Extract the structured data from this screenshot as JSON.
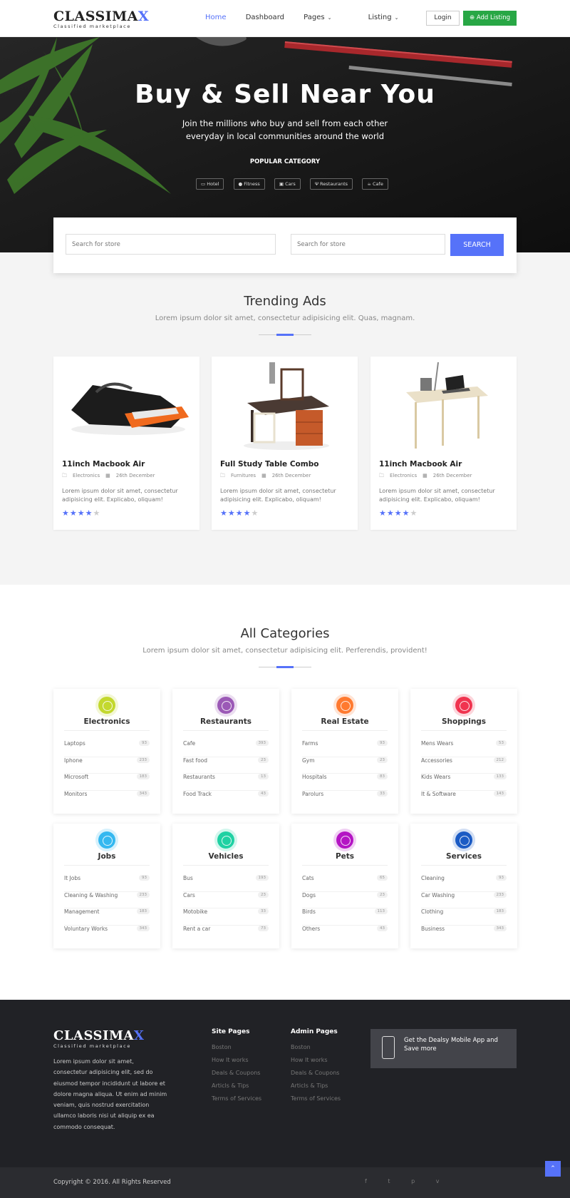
{
  "brand": {
    "name_main": "CLASSIMA",
    "name_accent": "X",
    "tagline": "Classified marketplace"
  },
  "nav": {
    "items": [
      {
        "label": "Home",
        "active": true
      },
      {
        "label": "Dashboard"
      },
      {
        "label": "Pages",
        "dropdown": true
      },
      {
        "label": "Listing",
        "dropdown": true
      }
    ],
    "login_label": "Login",
    "add_listing_label": "Add Listing",
    "add_listing_icon": "plus-circle-icon"
  },
  "hero": {
    "title": "Buy & Sell Near You",
    "subtitle": "Join the millions who buy and sell from each other everyday in local communities around the world",
    "popular_label": "POPULAR CATEGORY",
    "popular_items": [
      {
        "label": "Hotel",
        "icon": "bed-icon"
      },
      {
        "label": "Fitness",
        "icon": "fitness-icon"
      },
      {
        "label": "Cars",
        "icon": "car-icon"
      },
      {
        "label": "Restaurants",
        "icon": "cutlery-icon"
      },
      {
        "label": "Cafe",
        "icon": "coffee-icon"
      }
    ]
  },
  "search": {
    "placeholder_1": "Search for store",
    "placeholder_2": "Search for store",
    "button_label": "SEARCH"
  },
  "trending": {
    "title": "Trending Ads",
    "description": "Lorem ipsum dolor sit amet, consectetur adipisicing elit. Quas, magnam.",
    "cards": [
      {
        "title": "11inch Macbook Air",
        "category": "Electronics",
        "date": "26th December",
        "description": "Lorem ipsum dolor sit amet, consectetur adipisicing elit. Explicabo, oliquam!",
        "rating": 4,
        "rating_max": 5
      },
      {
        "title": "Full Study Table Combo",
        "category": "Furnitures",
        "date": "26th December",
        "description": "Lorem ipsum dolor sit amet, consectetur adipisicing elit. Explicabo, oliquam!",
        "rating": 4,
        "rating_max": 5
      },
      {
        "title": "11inch Macbook Air",
        "category": "Electronics",
        "date": "26th December",
        "description": "Lorem ipsum dolor sit amet, consectetur adipisicing elit. Explicabo, oliquam!",
        "rating": 4,
        "rating_max": 5
      }
    ]
  },
  "categories": {
    "title": "All Categories",
    "description": "Lorem ipsum dolor sit amet, consectetur adipisicing elit. Perferendis, provident!",
    "items": [
      {
        "name": "Electronics",
        "color": "#c3d82e",
        "icon": "laptop-icon",
        "subs": [
          [
            "Laptops",
            "93"
          ],
          [
            "Iphone",
            "233"
          ],
          [
            "Microsoft",
            "183"
          ],
          [
            "Monitors",
            "343"
          ]
        ]
      },
      {
        "name": "Restaurants",
        "color": "#9b59b6",
        "icon": "apple-icon",
        "subs": [
          [
            "Cafe",
            "393"
          ],
          [
            "Fast food",
            "23"
          ],
          [
            "Restaurants",
            "13"
          ],
          [
            "Food Track",
            "43"
          ]
        ]
      },
      {
        "name": "Real Estate",
        "color": "#ff7a2f",
        "icon": "home-icon",
        "subs": [
          [
            "Farms",
            "93"
          ],
          [
            "Gym",
            "23"
          ],
          [
            "Hospitals",
            "83"
          ],
          [
            "Parolurs",
            "33"
          ]
        ]
      },
      {
        "name": "Shoppings",
        "color": "#f0344f",
        "icon": "shopping-cart-icon",
        "subs": [
          [
            "Mens Wears",
            "53"
          ],
          [
            "Accessories",
            "212"
          ],
          [
            "Kids Wears",
            "133"
          ],
          [
            "It & Software",
            "143"
          ]
        ]
      },
      {
        "name": "Jobs",
        "color": "#34b8f0",
        "icon": "briefcase-icon",
        "subs": [
          [
            "It Jobs",
            "93"
          ],
          [
            "Cleaning & Washing",
            "233"
          ],
          [
            "Management",
            "183"
          ],
          [
            "Voluntary Works",
            "343"
          ]
        ]
      },
      {
        "name": "Vehicles",
        "color": "#1fd1a3",
        "icon": "car-icon",
        "subs": [
          [
            "Bus",
            "193"
          ],
          [
            "Cars",
            "23"
          ],
          [
            "Motobike",
            "33"
          ],
          [
            "Rent a car",
            "73"
          ]
        ]
      },
      {
        "name": "Pets",
        "color": "#b414c4",
        "icon": "paw-icon",
        "subs": [
          [
            "Cats",
            "65"
          ],
          [
            "Dogs",
            "23"
          ],
          [
            "Birds",
            "113"
          ],
          [
            "Others",
            "43"
          ]
        ]
      },
      {
        "name": "Services",
        "color": "#1b5bc4",
        "icon": "laptop-icon",
        "subs": [
          [
            "Cleaning",
            "93"
          ],
          [
            "Car Washing",
            "233"
          ],
          [
            "Clothing",
            "183"
          ],
          [
            "Business",
            "343"
          ]
        ]
      }
    ]
  },
  "footer": {
    "description": "Lorem ipsum dolor sit amet, consectetur adipisicing elit, sed do eiusmod tempor incididunt ut labore et dolore magna aliqua. Ut enim ad minim veniam, quis nostrud exercitation ullamco laboris nisi ut aliquip ex ea commodo consequat.",
    "site_pages_title": "Site Pages",
    "site_pages": [
      "Boston",
      "How It works",
      "Deals & Coupons",
      "Articls & Tips",
      "Terms of Services"
    ],
    "admin_pages_title": "Admin Pages",
    "admin_pages": [
      "Boston",
      "How It works",
      "Deals & Coupons",
      "Articls & Tips",
      "Terms of Services"
    ],
    "app_text": "Get the Dealsy Mobile App and Save more",
    "copyright": "Copyright © 2016. All Rights Reserved",
    "social": [
      "f",
      "t",
      "p",
      "v"
    ],
    "colors": {
      "background": "#212226",
      "accent": "#5672f9",
      "success": "#28a745"
    }
  }
}
